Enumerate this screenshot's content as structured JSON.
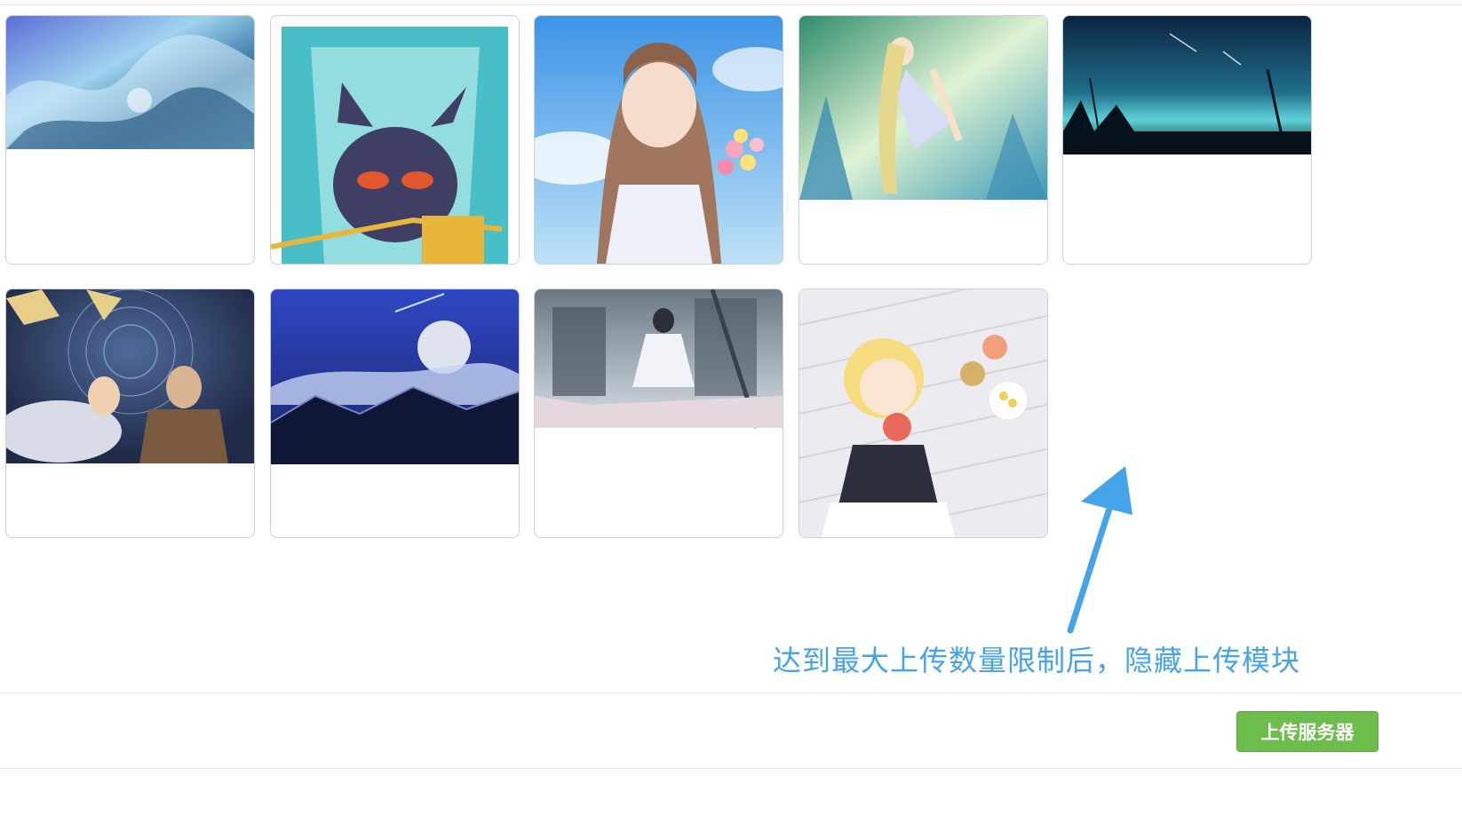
{
  "gallery": {
    "items": [
      {
        "name": "ocean-wave-art",
        "dominant_color": "#5a8fc7"
      },
      {
        "name": "gengar-cartoon",
        "dominant_color": "#3fbcc4"
      },
      {
        "name": "anime-girl-bouquet",
        "dominant_color": "#8cc6ec"
      },
      {
        "name": "anime-girl-crystal-forest",
        "dominant_color": "#7fc79a"
      },
      {
        "name": "night-sky-meteor",
        "dominant_color": "#0d2b44"
      },
      {
        "name": "characters-with-yak",
        "dominant_color": "#2d3a5e"
      },
      {
        "name": "moon-over-mountains",
        "dominant_color": "#23389b"
      },
      {
        "name": "girl-in-ruins",
        "dominant_color": "#8e9aa7"
      },
      {
        "name": "maid-girl-blonde",
        "dominant_color": "#e9e9ec"
      }
    ]
  },
  "annotation": {
    "text": "达到最大上传数量限制后，隐藏上传模块",
    "color": "#45a3e8"
  },
  "footer": {
    "upload_button_label": "上传服务器",
    "button_color": "#6cbd4b"
  }
}
